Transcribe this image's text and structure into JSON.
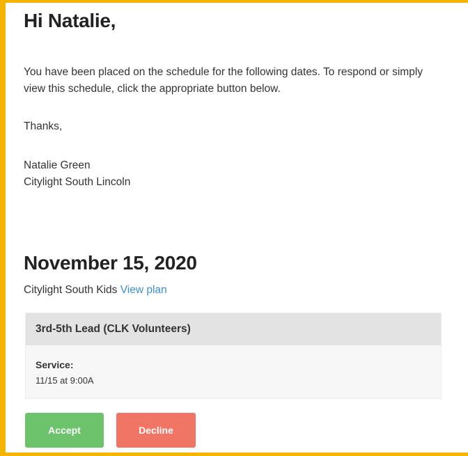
{
  "greeting": "Hi Natalie,",
  "intro": "You have been placed on the schedule for the following dates. To respond or simply view this schedule, click the appropriate button below.",
  "thanks": "Thanks,",
  "signature": {
    "name": "Natalie Green",
    "org": "Citylight South Lincoln"
  },
  "schedule": {
    "date": "November 15, 2020",
    "plan_name": "Citylight South Kids",
    "plan_link": "View plan",
    "position": "3rd-5th Lead (CLK Volunteers)",
    "service_label": "Service:",
    "service_time": "11/15 at 9:00A"
  },
  "actions": {
    "accept": "Accept",
    "decline": "Decline"
  },
  "colors": {
    "frame": "#f5b400",
    "accept": "#6cc36c",
    "decline": "#f07565",
    "link": "#3a8fd8"
  }
}
